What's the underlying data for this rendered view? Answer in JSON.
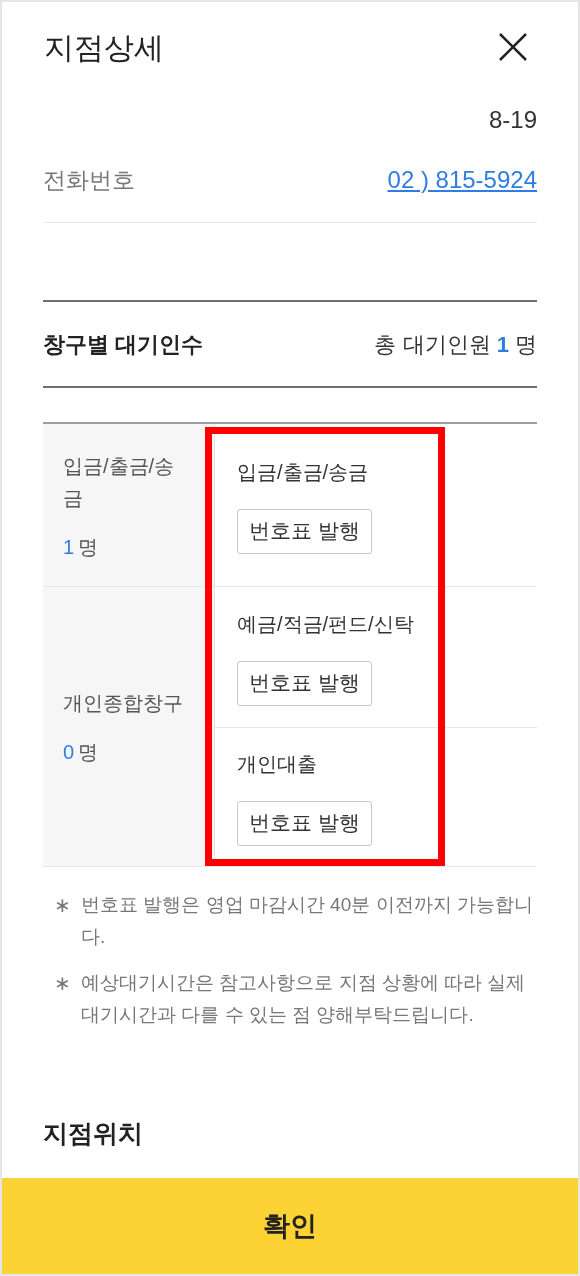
{
  "header": {
    "title": "지점상세"
  },
  "address_tail": "8-19",
  "phone": {
    "label": "전화번호",
    "value": "02 ) 815-5924"
  },
  "queue": {
    "title": "창구별 대기인수",
    "total_label": "총 대기인원",
    "total_count": "1",
    "total_unit": "명"
  },
  "windows": [
    {
      "name": "입금/출금/송금",
      "count": "1",
      "unit": "명",
      "services": [
        {
          "name": "입금/출금/송금",
          "button": "번호표 발행"
        }
      ]
    },
    {
      "name": "개인종합창구",
      "count": "0",
      "unit": "명",
      "services": [
        {
          "name": "예금/적금/펀드/신탁",
          "button": "번호표 발행"
        },
        {
          "name": "개인대출",
          "button": "번호표 발행"
        }
      ]
    }
  ],
  "services_highlighted": true,
  "notes": [
    {
      "mark": "∗",
      "text": "번호표 발행은 영업 마감시간 40분 이전까지 가능합니다."
    },
    {
      "mark": "∗",
      "text": "예상대기시간은 참고사항으로 지점 상황에 따라 실제 대기시간과 다를 수 있는 점 양해부탁드립니다."
    }
  ],
  "location_title": "지점위치",
  "confirm": "확인"
}
